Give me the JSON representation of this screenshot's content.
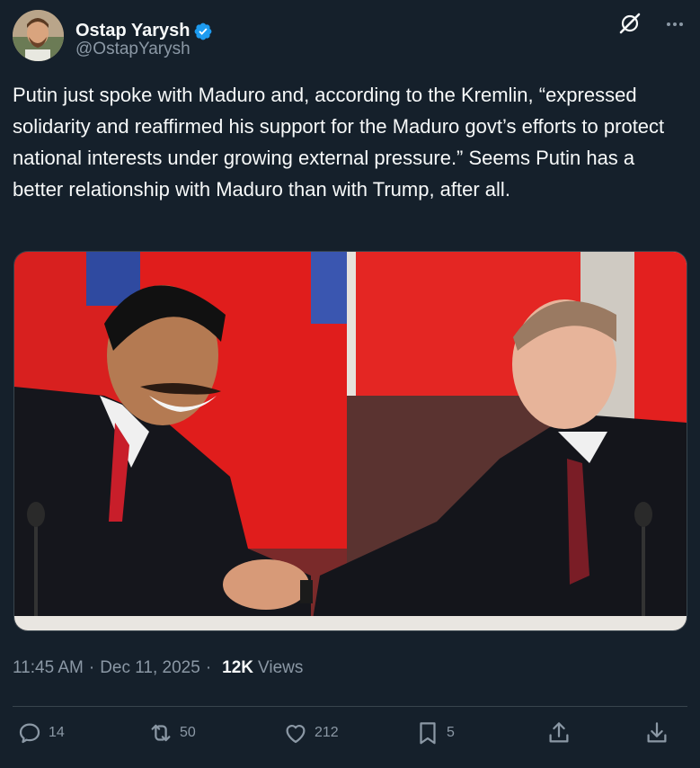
{
  "author": {
    "display_name": "Ostap Yarysh",
    "handle": "@OstapYarysh"
  },
  "tweet": {
    "text": "Putin just spoke with Maduro and, according to the Kremlin, “expressed solidarity and reaffirmed his support for the Maduro govt’s efforts to protect national interests under growing external pressure.” Seems Putin has a better relationship with Maduro than with Trump, after all."
  },
  "meta": {
    "time": "11:45 AM",
    "dot1": "·",
    "date": "Dec 11, 2025",
    "dot2": "·",
    "views_count": "12K",
    "views_label": "Views"
  },
  "actions": {
    "replies": "14",
    "reposts": "50",
    "likes": "212",
    "bookmarks": "5"
  },
  "colors": {
    "background": "#15202b",
    "text": "#f7f9f9",
    "secondary": "#8b98a5",
    "verified": "#1d9bf0"
  }
}
